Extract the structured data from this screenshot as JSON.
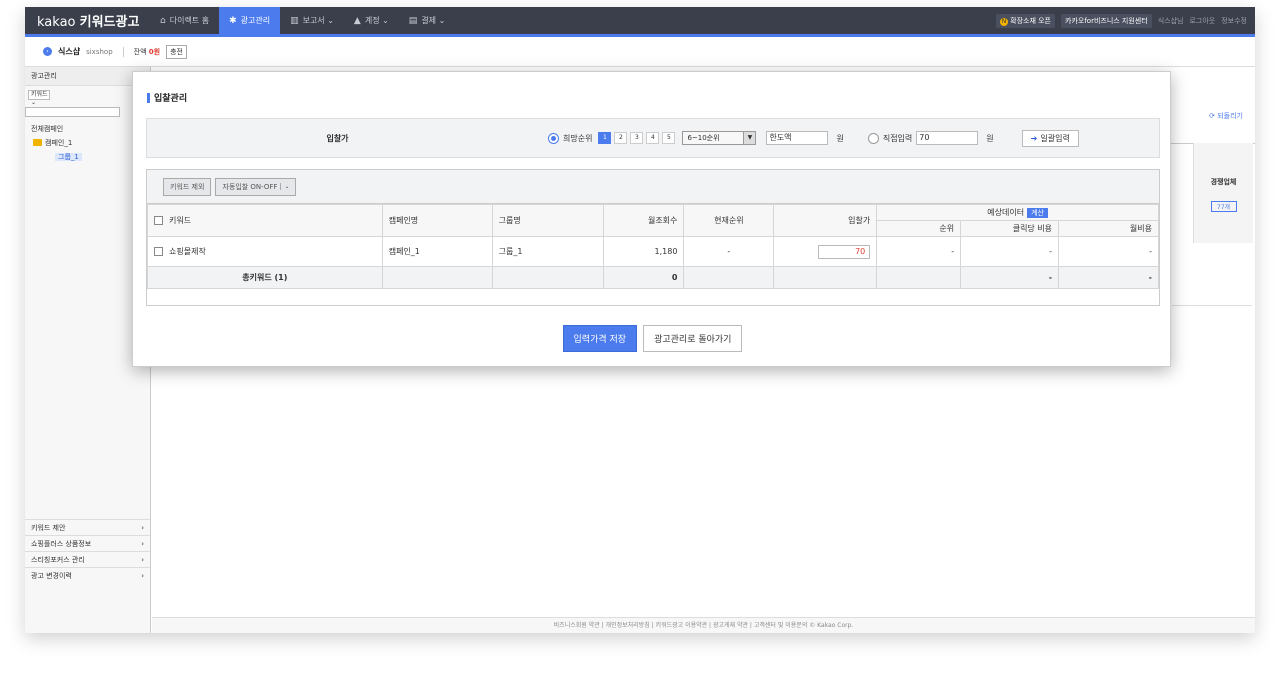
{
  "topbar": {
    "logo_main": "kakao",
    "logo_sub": "키워드광고",
    "menus": [
      {
        "label": "다이렉트 홈",
        "icon": "home-icon"
      },
      {
        "label": "광고관리",
        "icon": "gear-icon"
      },
      {
        "label": "보고서 ⌄",
        "icon": "chart-icon"
      },
      {
        "label": "계정 ⌄",
        "icon": "user-icon"
      },
      {
        "label": "결제 ⌄",
        "icon": "card-icon"
      }
    ],
    "right_badge1": "확장소재 오픈",
    "right_badge2": "카카오for비즈니스 지원센터",
    "right_links": [
      "식스샵님",
      "로그아웃",
      "정보수정"
    ]
  },
  "account": {
    "name": "식스샵",
    "id": "sixshop",
    "balance_label": "잔액",
    "balance_value": "0원",
    "charge_label": "충전"
  },
  "sidebar": {
    "title": "광고관리",
    "filter": "키워드",
    "tree": {
      "all": "전체캠페인",
      "campaign": "캠페인_1",
      "group": "그룹_1"
    },
    "bottom_items": [
      "키워드 제안",
      "쇼핑플러스 상품정보",
      "스티칭포커스 관리",
      "광고 변경이력"
    ]
  },
  "background": {
    "reload": "⟳ 되돌리기",
    "col_header": "경쟁업체",
    "col_button": "77개",
    "footer": "비즈니스회원 약관 | 개인정보처리방침 | 키워드광고 이용약관 | 광고게재 약관 | 고객센터 및 이용문의 © Kakao Corp."
  },
  "modal": {
    "title": "입찰관리",
    "bid": {
      "label": "입찰가",
      "rank_option_label": "희망순위",
      "ranks": [
        "1",
        "2",
        "3",
        "4",
        "5"
      ],
      "rank_select": "6~10순위",
      "limit_placeholder": "한도액",
      "won1": "원",
      "direct_label": "직접입력",
      "direct_value": "70",
      "won2": "원",
      "apply_label": "일괄입력"
    },
    "toolbar": {
      "exclude_label": "키워드 제외",
      "auto_label": "자동입찰 ON-OFF"
    },
    "table": {
      "headers": {
        "keyword": "키워드",
        "campaign": "캠페인명",
        "group": "그룹명",
        "monthly": "월조회수",
        "rank": "현재순위",
        "bid": "입찰가",
        "expected": "예상데이터",
        "calc": "계산",
        "exp_rank": "순위",
        "cpc": "클릭당 비용",
        "monthly_cost": "월비용"
      },
      "rows": [
        {
          "keyword": "쇼핑몰제작",
          "campaign": "캠페인_1",
          "group": "그룹_1",
          "monthly": "1,180",
          "rank": "-",
          "bid": "70",
          "exp_rank": "-",
          "cpc": "-",
          "monthly_cost": "-"
        }
      ],
      "total": {
        "label": "총키워드 (1)",
        "monthly": "0",
        "cpc": "-",
        "monthly_cost": "-"
      }
    },
    "save_label": "입력가격 저장",
    "back_label": "광고관리로 돌아가기"
  }
}
